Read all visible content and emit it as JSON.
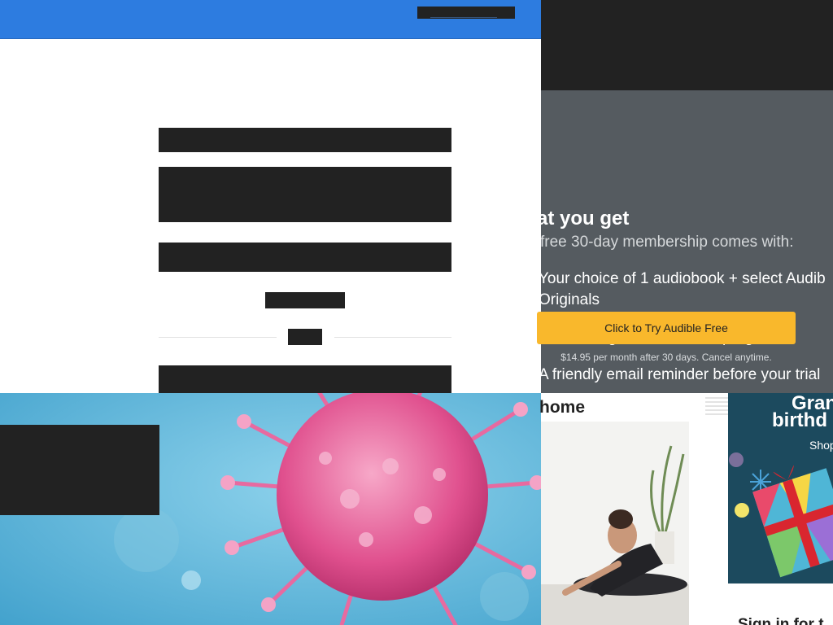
{
  "promo": {
    "title": "at you get",
    "subtitle": "free 30-day membership comes with:",
    "items": [
      "Your choice of 1 audiobook + select Audib",
      "Originals",
      "Exclusive guided wellness programs",
      "A friendly email reminder before your trial"
    ],
    "cta_label": "Click to Try Audible Free",
    "fine_print": "$14.95 per month after 30 days. Cancel anytime.",
    "cta_color": "#f9b82c",
    "panel_color": "#555b60"
  },
  "feed": {
    "home_heading": "home"
  },
  "gift_card": {
    "line1": "Gran",
    "line2": "birthd",
    "shop_label": "Shop"
  },
  "footer": {
    "signin_text": "Sign in for t"
  },
  "colors": {
    "topbar": "#2d7ce0",
    "redaction": "#222222"
  }
}
